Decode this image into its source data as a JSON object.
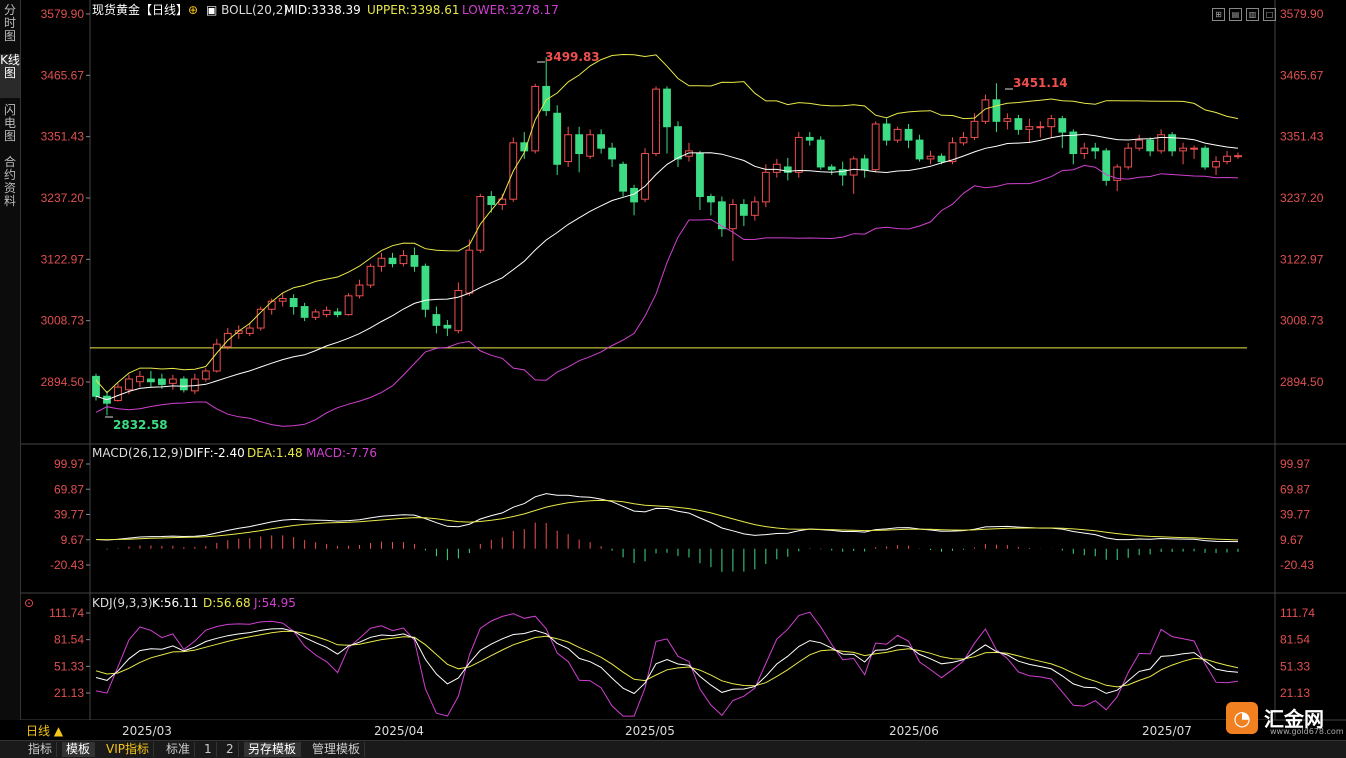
{
  "instrument_title": "现货黄金【日线】",
  "left_nav": [
    "分时图",
    "K线图",
    "闪电图",
    "合约资料"
  ],
  "boll": {
    "label": "BOLL(20,2)",
    "mid": "MID:3338.39",
    "upper": "UPPER:3398.61",
    "lower": "LOWER:3278.17"
  },
  "price_axis": [
    "3579.90",
    "3465.67",
    "3351.43",
    "3237.20",
    "3122.97",
    "3008.73",
    "2894.50"
  ],
  "annotations": {
    "high1": "3499.83",
    "high2": "3451.14",
    "low": "2832.58"
  },
  "macd": {
    "label": "MACD(26,12,9)",
    "diff": "DIFF:-2.40",
    "dea": "DEA:1.48",
    "macd": "MACD:-7.76",
    "axis": [
      "99.97",
      "69.87",
      "39.77",
      "9.67",
      "-20.43"
    ]
  },
  "kdj": {
    "label": "KDJ(9,3,3)",
    "k": "K:56.11",
    "d": "D:56.68",
    "j": "J:54.95",
    "axis": [
      "111.74",
      "81.54",
      "51.33",
      "21.13"
    ]
  },
  "period": "日线 ▲",
  "dates": [
    "2025/03",
    "2025/04",
    "2025/05",
    "2025/06",
    "2025/07"
  ],
  "bottom_tabs": [
    "指标",
    "模板",
    "VIP指标",
    "标准",
    "1",
    "2",
    "另存模板",
    "管理模板"
  ],
  "logo_text": "汇金网",
  "logo_url": "www.gold678.com",
  "colors": {
    "up": "#ef4f4f",
    "down": "#3ddc84",
    "boll_mid": "#ffffff",
    "boll_upper": "#e8e84a",
    "boll_lower": "#d040d0",
    "hline": "#e8e84a"
  },
  "chart_data": {
    "type": "candlestick",
    "horizontal_line": 2958,
    "candles": [
      [
        2905,
        2868,
        2910,
        2860
      ],
      [
        2868,
        2855,
        2878,
        2832.58
      ],
      [
        2860,
        2885,
        2892,
        2858
      ],
      [
        2880,
        2900,
        2908,
        2872
      ],
      [
        2895,
        2905,
        2915,
        2885
      ],
      [
        2900,
        2895,
        2915,
        2885
      ],
      [
        2900,
        2890,
        2910,
        2882
      ],
      [
        2892,
        2900,
        2908,
        2880
      ],
      [
        2900,
        2880,
        2905,
        2875
      ],
      [
        2878,
        2900,
        2910,
        2872
      ],
      [
        2900,
        2915,
        2920,
        2895
      ],
      [
        2915,
        2965,
        2975,
        2912
      ],
      [
        2960,
        2985,
        2995,
        2955
      ],
      [
        2985,
        2990,
        3000,
        2975
      ],
      [
        2985,
        2995,
        3005,
        2980
      ],
      [
        2995,
        3030,
        3035,
        2990
      ],
      [
        3030,
        3045,
        3050,
        3020
      ],
      [
        3045,
        3050,
        3060,
        3035
      ],
      [
        3050,
        3035,
        3058,
        3020
      ],
      [
        3035,
        3015,
        3042,
        3008
      ],
      [
        3015,
        3025,
        3030,
        3010
      ],
      [
        3020,
        3028,
        3035,
        3015
      ],
      [
        3025,
        3020,
        3032,
        3015
      ],
      [
        3020,
        3055,
        3060,
        3018
      ],
      [
        3055,
        3075,
        3085,
        3050
      ],
      [
        3075,
        3110,
        3115,
        3070
      ],
      [
        3110,
        3125,
        3135,
        3100
      ],
      [
        3125,
        3115,
        3135,
        3108
      ],
      [
        3115,
        3130,
        3140,
        3110
      ],
      [
        3130,
        3110,
        3145,
        3100
      ],
      [
        3110,
        3030,
        3115,
        3015
      ],
      [
        3020,
        3000,
        3035,
        2985
      ],
      [
        3000,
        2995,
        3010,
        2980
      ],
      [
        2990,
        3065,
        3080,
        2985
      ],
      [
        3060,
        3140,
        3160,
        3055
      ],
      [
        3140,
        3240,
        3245,
        3135
      ],
      [
        3240,
        3225,
        3250,
        3210
      ],
      [
        3225,
        3235,
        3245,
        3215
      ],
      [
        3235,
        3340,
        3350,
        3230
      ],
      [
        3340,
        3325,
        3360,
        3310
      ],
      [
        3325,
        3445,
        3450,
        3320
      ],
      [
        3445,
        3400,
        3499.83,
        3390
      ],
      [
        3395,
        3300,
        3410,
        3280
      ],
      [
        3305,
        3355,
        3370,
        3295
      ],
      [
        3355,
        3320,
        3370,
        3285
      ],
      [
        3315,
        3355,
        3365,
        3310
      ],
      [
        3355,
        3330,
        3365,
        3320
      ],
      [
        3330,
        3310,
        3340,
        3295
      ],
      [
        3300,
        3250,
        3305,
        3240
      ],
      [
        3255,
        3230,
        3262,
        3205
      ],
      [
        3235,
        3320,
        3330,
        3230
      ],
      [
        3320,
        3440,
        3445,
        3315
      ],
      [
        3440,
        3370,
        3445,
        3320
      ],
      [
        3370,
        3310,
        3380,
        3295
      ],
      [
        3315,
        3325,
        3340,
        3305
      ],
      [
        3320,
        3240,
        3325,
        3215
      ],
      [
        3240,
        3230,
        3245,
        3205
      ],
      [
        3230,
        3180,
        3240,
        3165
      ],
      [
        3180,
        3225,
        3235,
        3120
      ],
      [
        3225,
        3205,
        3235,
        3185
      ],
      [
        3205,
        3230,
        3240,
        3195
      ],
      [
        3230,
        3285,
        3300,
        3220
      ],
      [
        3285,
        3300,
        3310,
        3275
      ],
      [
        3295,
        3285,
        3312,
        3270
      ],
      [
        3285,
        3350,
        3360,
        3275
      ],
      [
        3350,
        3345,
        3360,
        3335
      ],
      [
        3345,
        3295,
        3352,
        3290
      ],
      [
        3295,
        3290,
        3300,
        3280
      ],
      [
        3290,
        3280,
        3305,
        3260
      ],
      [
        3280,
        3310,
        3315,
        3245
      ],
      [
        3310,
        3290,
        3318,
        3275
      ],
      [
        3290,
        3375,
        3380,
        3285
      ],
      [
        3375,
        3345,
        3385,
        3335
      ],
      [
        3345,
        3365,
        3370,
        3340
      ],
      [
        3365,
        3345,
        3375,
        3330
      ],
      [
        3345,
        3310,
        3355,
        3305
      ],
      [
        3310,
        3315,
        3325,
        3300
      ],
      [
        3315,
        3305,
        3320,
        3300
      ],
      [
        3305,
        3340,
        3350,
        3300
      ],
      [
        3340,
        3350,
        3360,
        3335
      ],
      [
        3350,
        3380,
        3395,
        3345
      ],
      [
        3380,
        3420,
        3430,
        3375
      ],
      [
        3420,
        3380,
        3451.14,
        3360
      ],
      [
        3380,
        3385,
        3395,
        3365
      ],
      [
        3385,
        3365,
        3392,
        3355
      ],
      [
        3365,
        3370,
        3385,
        3340
      ],
      [
        3370,
        3370,
        3380,
        3350
      ],
      [
        3370,
        3385,
        3392,
        3350
      ],
      [
        3385,
        3360,
        3390,
        3330
      ],
      [
        3360,
        3320,
        3365,
        3300
      ],
      [
        3320,
        3330,
        3340,
        3310
      ],
      [
        3330,
        3325,
        3340,
        3310
      ],
      [
        3325,
        3270,
        3330,
        3260
      ],
      [
        3270,
        3295,
        3300,
        3250
      ],
      [
        3295,
        3330,
        3340,
        3290
      ],
      [
        3330,
        3345,
        3355,
        3325
      ],
      [
        3345,
        3325,
        3350,
        3315
      ],
      [
        3325,
        3355,
        3365,
        3320
      ],
      [
        3355,
        3325,
        3360,
        3315
      ],
      [
        3325,
        3330,
        3340,
        3300
      ],
      [
        3330,
        3330,
        3335,
        3310
      ],
      [
        3330,
        3295,
        3335,
        3290
      ],
      [
        3295,
        3305,
        3315,
        3280
      ],
      [
        3305,
        3315,
        3325,
        3300
      ],
      [
        3315,
        3316,
        3322,
        3310
      ]
    ],
    "price_axis_range": [
      2780,
      3580
    ],
    "boll_mid_last": 3338.39,
    "boll_upper_last": 3398.61,
    "boll_lower_last": 3278.17
  }
}
